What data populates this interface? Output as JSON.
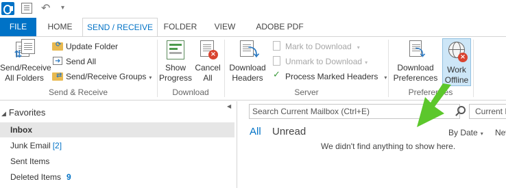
{
  "tabs": {
    "file": "FILE",
    "home": "HOME",
    "send_receive": "SEND / RECEIVE",
    "folder": "FOLDER",
    "view": "VIEW",
    "adobe_pdf": "ADOBE PDF"
  },
  "ribbon": {
    "send_receive_group": {
      "label": "Send & Receive",
      "send_receive_all_line1": "Send/Receive",
      "send_receive_all_line2": "All Folders",
      "update_folder": "Update Folder",
      "send_all": "Send All",
      "send_receive_groups": "Send/Receive Groups"
    },
    "download_group": {
      "label": "Download",
      "show_progress_line1": "Show",
      "show_progress_line2": "Progress",
      "cancel_all_line1": "Cancel",
      "cancel_all_line2": "All"
    },
    "server_group": {
      "label": "Server",
      "download_headers_line1": "Download",
      "download_headers_line2": "Headers",
      "mark_to_download": "Mark to Download",
      "unmark_to_download": "Unmark to Download",
      "process_marked_headers": "Process Marked Headers"
    },
    "preferences_group": {
      "label": "Preferences",
      "download_preferences_line1": "Download",
      "download_preferences_line2": "Preferences",
      "work_offline_line1": "Work",
      "work_offline_line2": "Offline"
    }
  },
  "nav": {
    "favorites": "Favorites",
    "items": [
      {
        "label": "Inbox",
        "count": ""
      },
      {
        "label": "Junk Email",
        "count": "[2]"
      },
      {
        "label": "Sent Items",
        "count": ""
      },
      {
        "label": "Deleted Items",
        "count": "9"
      }
    ]
  },
  "main": {
    "search_placeholder": "Search Current Mailbox (Ctrl+E)",
    "scope": "Current M",
    "filter_all": "All",
    "filter_unread": "Unread",
    "sort": "By Date",
    "sort_secondary": "New",
    "empty_message": "We didn't find anything to show here."
  },
  "colors": {
    "accent": "#0072c6",
    "annotation_arrow": "#5cc72c",
    "active_button_bg": "#cde6f7"
  }
}
